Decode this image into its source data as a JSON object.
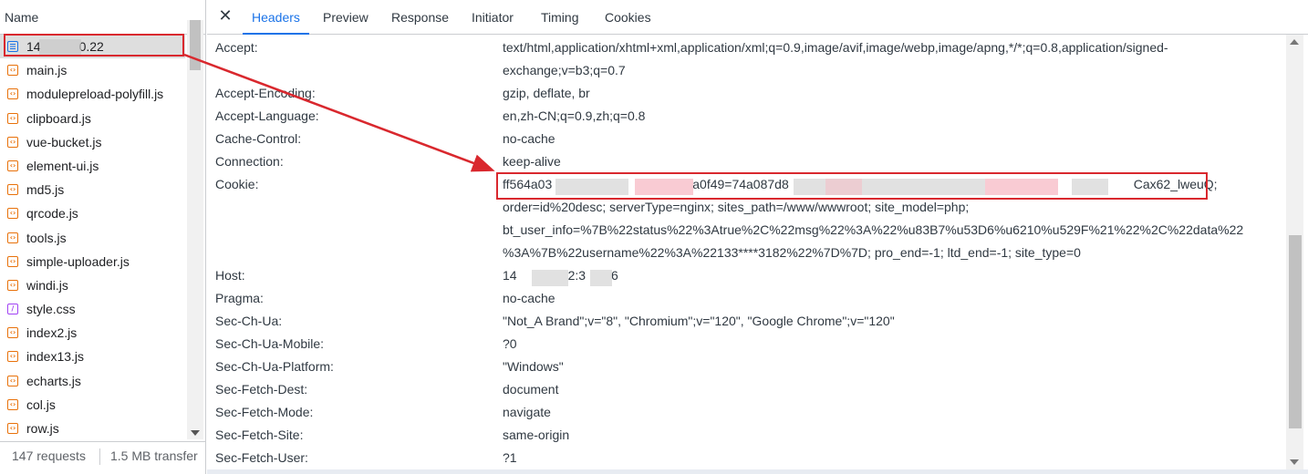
{
  "left_panel": {
    "column_header": "Name",
    "files": [
      {
        "name": "14   0.22",
        "type": "doc",
        "selected": true
      },
      {
        "name": "main.js",
        "type": "js"
      },
      {
        "name": "modulepreload-polyfill.js",
        "type": "js"
      },
      {
        "name": "clipboard.js",
        "type": "js"
      },
      {
        "name": "vue-bucket.js",
        "type": "js"
      },
      {
        "name": "element-ui.js",
        "type": "js"
      },
      {
        "name": "md5.js",
        "type": "js"
      },
      {
        "name": "qrcode.js",
        "type": "js"
      },
      {
        "name": "tools.js",
        "type": "js"
      },
      {
        "name": "simple-uploader.js",
        "type": "js"
      },
      {
        "name": "windi.js",
        "type": "js"
      },
      {
        "name": "style.css",
        "type": "css"
      },
      {
        "name": "index2.js",
        "type": "js"
      },
      {
        "name": "index13.js",
        "type": "js"
      },
      {
        "name": "echarts.js",
        "type": "js"
      },
      {
        "name": "col.js",
        "type": "js"
      },
      {
        "name": "row.js",
        "type": "js"
      }
    ],
    "footer": {
      "requests": "147 requests",
      "transferred": "1.5 MB transfer"
    }
  },
  "tabs": {
    "close_icon": "close-icon",
    "items": [
      "Headers",
      "Preview",
      "Response",
      "Initiator",
      "Timing",
      "Cookies"
    ],
    "active": "Headers"
  },
  "headers": [
    {
      "name": "Accept:",
      "value_lines": [
        "text/html,application/xhtml+xml,application/xml;q=0.9,image/avif,image/webp,image/apng,*/*;q=0.8,application/signed-",
        "exchange;v=b3;q=0.7"
      ]
    },
    {
      "name": "Accept-Encoding:",
      "value_lines": [
        "gzip, deflate, br"
      ]
    },
    {
      "name": "Accept-Language:",
      "value_lines": [
        "en,zh-CN;q=0.9,zh;q=0.8"
      ]
    },
    {
      "name": "Cache-Control:",
      "value_lines": [
        "no-cache"
      ]
    },
    {
      "name": "Connection:",
      "value_lines": [
        "keep-alive"
      ]
    },
    {
      "name": "Cookie:",
      "value_lines": [
        "ff564a03           a0f49=74a087d8                           Cax62_lweuQ;",
        "order=id%20desc; serverType=nginx; sites_path=/www/wwwroot; site_model=php;",
        "bt_user_info=%7B%22status%22%3Atrue%2C%22msg%22%3A%22%u83B7%u53D6%u6210%u529F%21%22%2C%22data%22",
        "%3A%7B%22username%22%3A%22133****3182%22%7D%7D; pro_end=-1; ltd_end=-1; site_type=0"
      ]
    },
    {
      "name": "Host:",
      "value_lines": [
        "14    2:3  6"
      ]
    },
    {
      "name": "Pragma:",
      "value_lines": [
        "no-cache"
      ]
    },
    {
      "name": "Sec-Ch-Ua:",
      "value_lines": [
        "\"Not_A Brand\";v=\"8\", \"Chromium\";v=\"120\", \"Google Chrome\";v=\"120\""
      ]
    },
    {
      "name": "Sec-Ch-Ua-Mobile:",
      "value_lines": [
        "?0"
      ]
    },
    {
      "name": "Sec-Ch-Ua-Platform:",
      "value_lines": [
        "\"Windows\""
      ]
    },
    {
      "name": "Sec-Fetch-Dest:",
      "value_lines": [
        "document"
      ]
    },
    {
      "name": "Sec-Fetch-Mode:",
      "value_lines": [
        "navigate"
      ]
    },
    {
      "name": "Sec-Fetch-Site:",
      "value_lines": [
        "same-origin"
      ]
    },
    {
      "name": "Sec-Fetch-User:",
      "value_lines": [
        "?1"
      ]
    }
  ],
  "colors": {
    "accent": "#1a73e8",
    "annotation_red": "#d9282e",
    "js_icon": "#e8710a",
    "css_icon": "#a142f4"
  }
}
